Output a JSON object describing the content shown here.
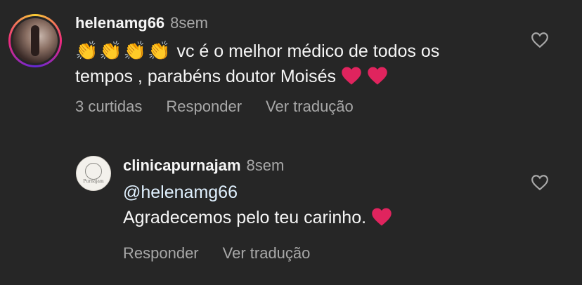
{
  "comments": [
    {
      "username": "helenamg66",
      "time": "8sem",
      "emojis": [
        "👏",
        "👏",
        "👏",
        "👏"
      ],
      "line1": "vc é o melhor médico de todos os",
      "line2": "tempos , parabéns doutor Moisés",
      "likes": "3 curtidas",
      "reply": "Responder",
      "translate": "Ver tradução"
    },
    {
      "username": "clinicapurnajam",
      "time": "8sem",
      "mention": "@helenamg66",
      "text": "Agradecemos pelo teu carinho.",
      "avatar_text": "Purnajam",
      "reply": "Responder",
      "translate": "Ver tradução"
    }
  ],
  "colors": {
    "background": "#262626",
    "primary_text": "#f5f5f5",
    "secondary_text": "#a8a8a8",
    "heart_red": "#e0245e"
  },
  "icons": {
    "like": "heart-outline-icon",
    "emoji_heart": "red-heart-icon",
    "emoji_clap": "clapping-hands-icon"
  }
}
